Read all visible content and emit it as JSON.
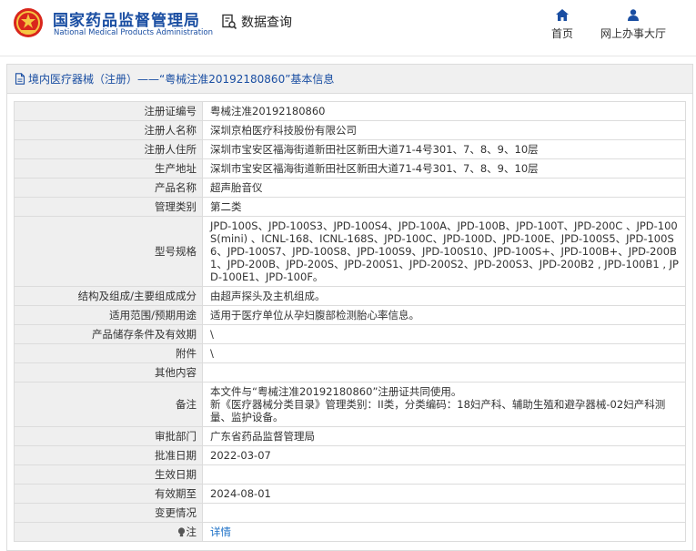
{
  "header": {
    "brand_cn": "国家药品监督管理局",
    "brand_en": "National Medical Products Administration",
    "query_label": "数据查询",
    "nav_home": "首页",
    "nav_hall": "网上办事大厅",
    "brand_color": "#1a4ea2"
  },
  "panel": {
    "title": "境内医疗器械（注册）——“粤械注准20192180860”基本信息"
  },
  "rows": [
    {
      "key": "注册证编号",
      "value": "粤械注准20192180860"
    },
    {
      "key": "注册人名称",
      "value": "深圳京柏医疗科技股份有限公司"
    },
    {
      "key": "注册人住所",
      "value": "深圳市宝安区福海街道新田社区新田大道71-4号301、7、8、9、10层"
    },
    {
      "key": "生产地址",
      "value": "深圳市宝安区福海街道新田社区新田大道71-4号301、7、8、9、10层"
    },
    {
      "key": "产品名称",
      "value": "超声胎音仪"
    },
    {
      "key": "管理类别",
      "value": "第二类"
    },
    {
      "key": "型号规格",
      "value": "JPD-100S、JPD-100S3、JPD-100S4、JPD-100A、JPD-100B、JPD-100T、JPD-200C 、JPD-100S(mini) 、ICNL-168、ICNL-168S、JPD-100C、JPD-100D、JPD-100E、JPD-100S5、JPD-100S6、JPD-100S7、JPD-100S8、JPD-100S9、JPD-100S10、JPD-100S+、JPD-100B+、JPD-200B1、JPD-200B、JPD-200S、JPD-200S1、JPD-200S2、JPD-200S3、JPD-200B2 , JPD-100B1 , JPD-100E1、JPD-100F。"
    },
    {
      "key": "结构及组成/主要组成成分",
      "value": "由超声探头及主机组成。"
    },
    {
      "key": "适用范围/预期用途",
      "value": "适用于医疗单位从孕妇腹部检测胎心率信息。"
    },
    {
      "key": "产品储存条件及有效期",
      "value": "\\"
    },
    {
      "key": "附件",
      "value": "\\"
    },
    {
      "key": "其他内容",
      "value": ""
    },
    {
      "key": "备注",
      "value": "本文件与“粤械注准20192180860”注册证共同使用。\n新《医疗器械分类目录》管理类别：II类，分类编码：18妇产科、辅助生殖和避孕器械-02妇产科测量、监护设备。"
    },
    {
      "key": "审批部门",
      "value": "广东省药品监督管理局"
    },
    {
      "key": "批准日期",
      "value": "2022-03-07"
    },
    {
      "key": "生效日期",
      "value": ""
    },
    {
      "key": "有效期至",
      "value": "2024-08-01"
    },
    {
      "key": "变更情况",
      "value": ""
    }
  ],
  "note_row": {
    "key": "注",
    "link": "详情"
  }
}
